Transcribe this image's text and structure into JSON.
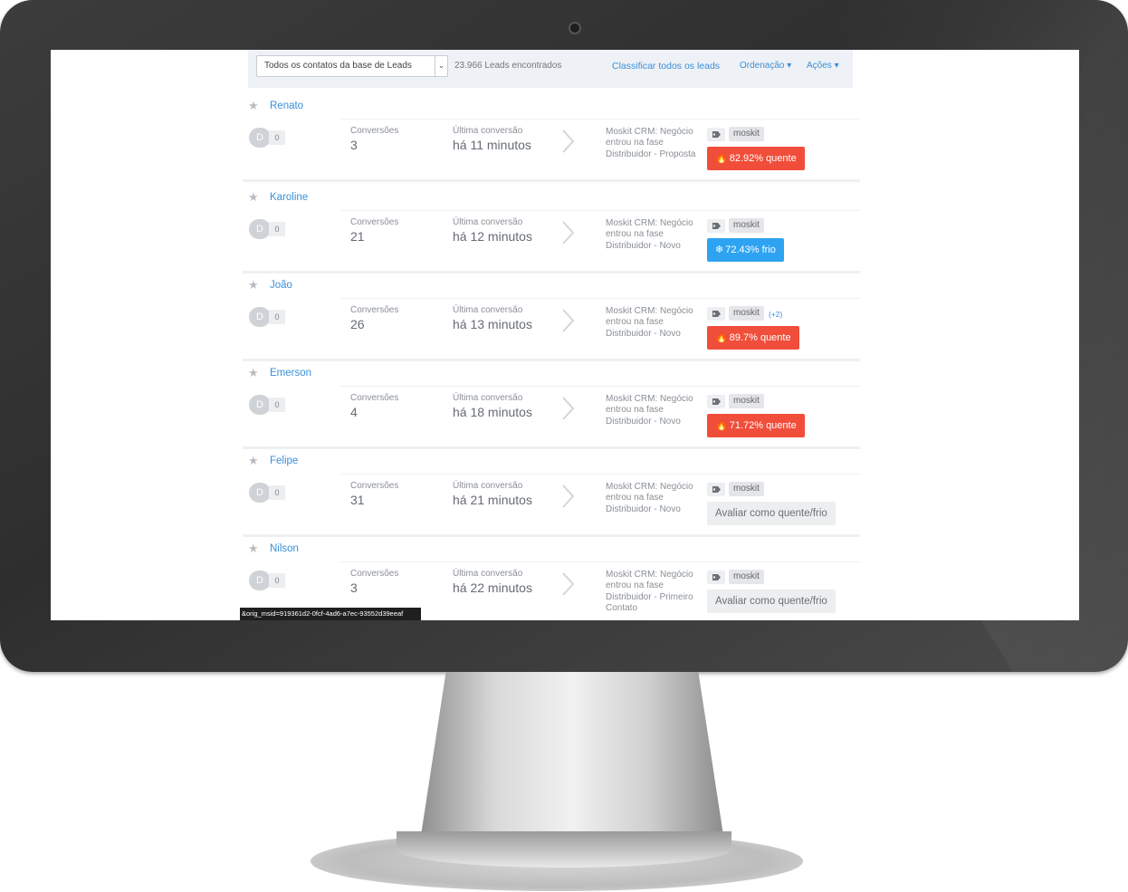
{
  "toolbar": {
    "filter_value": "Todos os contatos da base de Leads",
    "lead_count": "23.966 Leads encontrados",
    "classify_all": "Classificar todos os leads",
    "ordering": "Ordenação ▾",
    "actions": "Ações ▾"
  },
  "columns": {
    "conversions_label": "Conversões",
    "last_conversion_label": "Última conversão"
  },
  "leads": [
    {
      "name": "Renato",
      "avatar": "D",
      "score": "0",
      "conversions": "3",
      "last_conversion": "há 11 minutos",
      "stage": "Moskit CRM: Negócio entrou na fase Distribuidor - Proposta",
      "tag": "moskit",
      "tag_extra": "",
      "temperature": "82.92% quente",
      "temperature_type": "hot"
    },
    {
      "name": "Karoline",
      "avatar": "D",
      "score": "0",
      "conversions": "21",
      "last_conversion": "há 12 minutos",
      "stage": "Moskit CRM: Negócio entrou na fase Distribuidor - Novo",
      "tag": "moskit",
      "tag_extra": "",
      "temperature": "72.43% frio",
      "temperature_type": "cold"
    },
    {
      "name": "João",
      "avatar": "D",
      "score": "0",
      "conversions": "26",
      "last_conversion": "há 13 minutos",
      "stage": "Moskit CRM: Negócio entrou na fase Distribuidor - Novo",
      "tag": "moskit",
      "tag_extra": "(+2)",
      "temperature": "89.7% quente",
      "temperature_type": "hot"
    },
    {
      "name": "Emerson",
      "avatar": "D",
      "score": "0",
      "conversions": "4",
      "last_conversion": "há 18 minutos",
      "stage": "Moskit CRM: Negócio entrou na fase Distribuidor - Novo",
      "tag": "moskit",
      "tag_extra": "",
      "temperature": "71.72% quente",
      "temperature_type": "hot"
    },
    {
      "name": "Felipe",
      "avatar": "D",
      "score": "0",
      "conversions": "31",
      "last_conversion": "há 21 minutos",
      "stage": "Moskit CRM: Negócio entrou na fase Distribuidor - Novo",
      "tag": "moskit",
      "tag_extra": "",
      "temperature": "Avaliar como quente/frio",
      "temperature_type": "neutral"
    },
    {
      "name": "Nilson",
      "avatar": "D",
      "score": "0",
      "conversions": "3",
      "last_conversion": "há 22 minutos",
      "stage": "Moskit CRM: Negócio entrou na fase Distribuidor - Primeiro Contato",
      "tag": "moskit",
      "tag_extra": "",
      "temperature": "Avaliar como quente/frio",
      "temperature_type": "neutral"
    }
  ],
  "status_bar": "&orig_msid=919361d2-0fcf-4ad6-a7ec-93552d39eeaf",
  "colors": {
    "link": "#3b8fd9",
    "hot": "#f04e3a",
    "cold": "#2ea3f2",
    "bezel": "#333333"
  }
}
